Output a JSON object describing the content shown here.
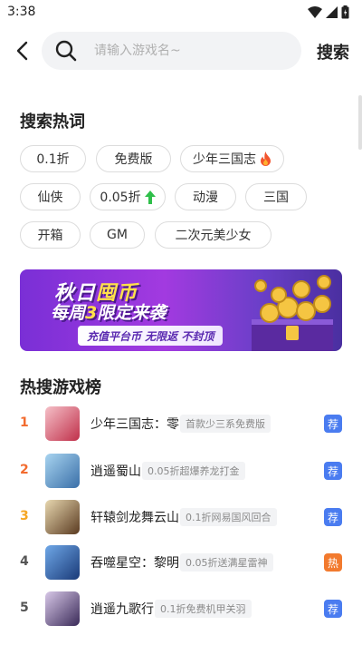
{
  "status": {
    "time": "3:38"
  },
  "search": {
    "placeholder": "请输入游戏名~",
    "value": "",
    "button_label": "搜索"
  },
  "hot_words": {
    "title": "搜索热词",
    "items": [
      {
        "label": "0.1折",
        "icon": null
      },
      {
        "label": "免费版",
        "icon": null
      },
      {
        "label": "少年三国志",
        "icon": "fire-icon"
      },
      {
        "label": "仙侠",
        "icon": null
      },
      {
        "label": "0.05折",
        "icon": "trend-up-icon"
      },
      {
        "label": "动漫",
        "icon": null
      },
      {
        "label": "三国",
        "icon": null
      },
      {
        "label": "开箱",
        "icon": null
      },
      {
        "label": "GM",
        "icon": null
      },
      {
        "label": "二次元美少女",
        "icon": null
      }
    ]
  },
  "banner": {
    "title_prefix": "秋日",
    "title_highlight": "囤币",
    "subtitle_prefix": "每周",
    "subtitle_highlight": "3",
    "subtitle_suffix": "限定来袭",
    "tagline": "充值平台币 无限返 不封顶"
  },
  "ranking": {
    "title": "热搜游戏榜",
    "rows": [
      {
        "rank": "1",
        "name": "少年三国志：零",
        "tag": "首款少三系免费版",
        "badge": "荐",
        "badge_color": "#4a7cf0",
        "rank_color": "#f26b2e",
        "thumb_colors": [
          "#f5c0c8",
          "#c0304a"
        ]
      },
      {
        "rank": "2",
        "name": "逍遥蜀山",
        "tag": "0.05折超爆养龙打金",
        "badge": "荐",
        "badge_color": "#4a7cf0",
        "rank_color": "#f26b2e",
        "thumb_colors": [
          "#a8d4f0",
          "#3a6fa8"
        ]
      },
      {
        "rank": "3",
        "name": "轩辕剑龙舞云山",
        "tag": "0.1折网易国风回合",
        "badge": "荐",
        "badge_color": "#4a7cf0",
        "rank_color": "#f5a623",
        "thumb_colors": [
          "#e8d8b0",
          "#5a3a20"
        ]
      },
      {
        "rank": "4",
        "name": "吞噬星空：黎明",
        "tag": "0.05折送满星雷神",
        "badge": "热",
        "badge_color": "#f27a2e",
        "rank_color": "#555555",
        "thumb_colors": [
          "#6fa8e8",
          "#1a3a78"
        ]
      },
      {
        "rank": "5",
        "name": "逍遥九歌行",
        "tag": "0.1折免费机甲关羽",
        "badge": "荐",
        "badge_color": "#4a7cf0",
        "rank_color": "#555555",
        "thumb_colors": [
          "#d8c8e8",
          "#3a2a58"
        ]
      }
    ]
  },
  "colors": {
    "accent": "#4a7cf0",
    "rank_top": "#f26b2e",
    "rank_third": "#f5a623",
    "hot_badge": "#f27a2e"
  }
}
